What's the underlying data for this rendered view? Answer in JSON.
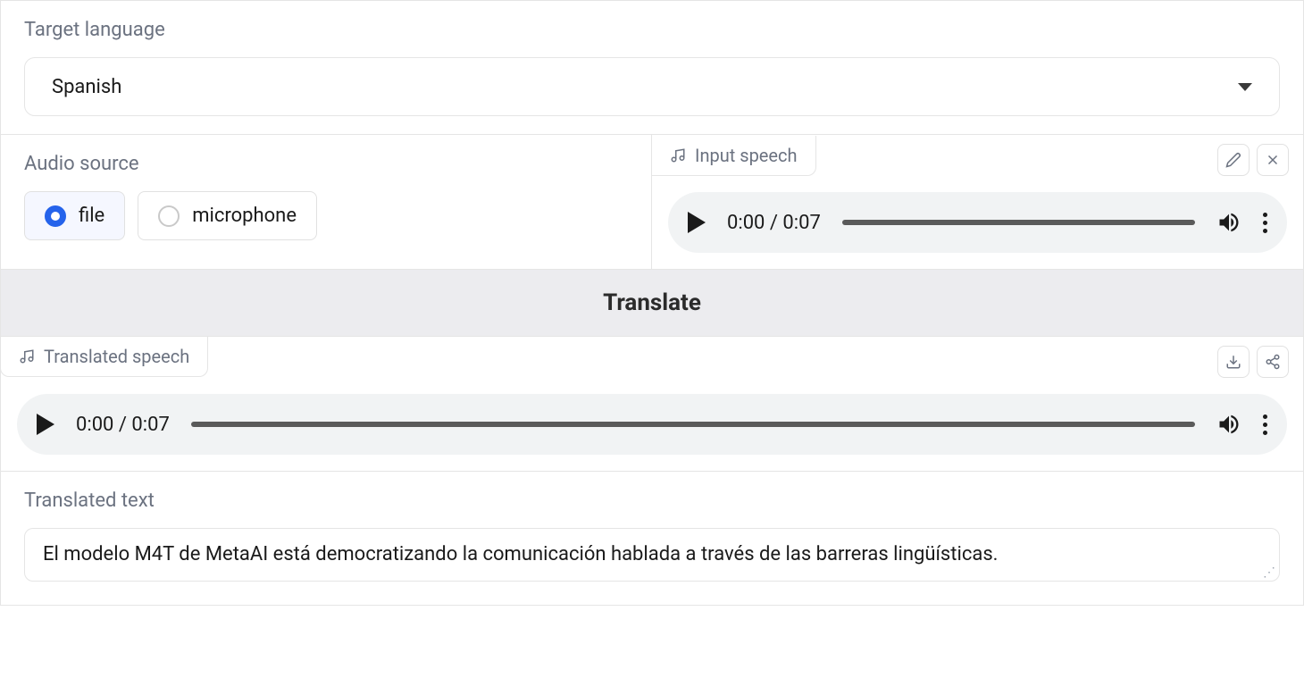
{
  "target_language": {
    "label": "Target language",
    "value": "Spanish"
  },
  "audio_source": {
    "label": "Audio source",
    "options": {
      "file": "file",
      "microphone": "microphone"
    },
    "selected": "file"
  },
  "input_speech": {
    "label": "Input speech",
    "current_time": "0:00",
    "duration": "0:07",
    "time_display": "0:00 / 0:07"
  },
  "translate_button": "Translate",
  "translated_speech": {
    "label": "Translated speech",
    "current_time": "0:00",
    "duration": "0:07",
    "time_display": "0:00 / 0:07"
  },
  "translated_text": {
    "label": "Translated text",
    "value": "El modelo M4T de MetaAI está democratizando la comunicación hablada a través de las barreras lingüísticas."
  }
}
